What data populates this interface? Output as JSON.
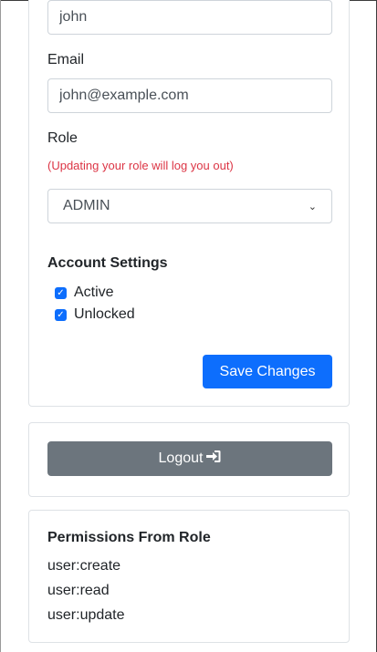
{
  "form": {
    "username_value": "john",
    "email_label": "Email",
    "email_value": "john@example.com",
    "role_label": "Role",
    "role_warning": "(Updating your role will log you out)",
    "role_selected": "ADMIN",
    "account_settings_heading": "Account Settings",
    "checkboxes": [
      {
        "label": "Active",
        "checked": true
      },
      {
        "label": "Unlocked",
        "checked": true
      }
    ],
    "save_label": "Save Changes"
  },
  "logout": {
    "label": "Logout",
    "icon": "sign-in-icon"
  },
  "permissions": {
    "heading": "Permissions From Role",
    "items": [
      "user:create",
      "user:read",
      "user:update"
    ]
  },
  "colors": {
    "primary": "#0d6efd",
    "secondary": "#6c757d",
    "danger": "#dc3545"
  }
}
